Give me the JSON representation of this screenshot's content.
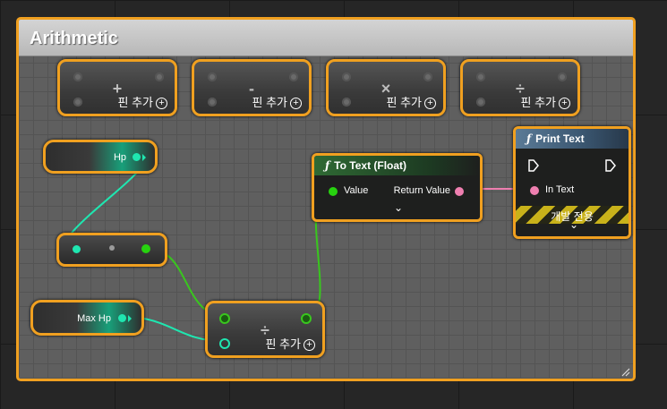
{
  "comment": {
    "title": "Arithmetic"
  },
  "operators": [
    {
      "symbol": "+",
      "add_pin": "핀 추가"
    },
    {
      "symbol": "-",
      "add_pin": "핀 추가"
    },
    {
      "symbol": "×",
      "add_pin": "핀 추가"
    },
    {
      "symbol": "÷",
      "add_pin": "핀 추가"
    }
  ],
  "variables": {
    "hp": "Hp",
    "max_hp": "Max Hp"
  },
  "divide_node": {
    "symbol": "÷",
    "add_pin": "핀 추가"
  },
  "to_text_node": {
    "title": "To Text (Float)",
    "input": "Value",
    "output": "Return Value",
    "expand": "⌄"
  },
  "print_text_node": {
    "title": "Print Text",
    "input": "In Text",
    "dev_only": "개발 전용",
    "expand": "⌄"
  },
  "icons": [
    "function-icon",
    "exec-pin-icon",
    "plus-circle-icon",
    "resize-grip-icon"
  ],
  "colors": {
    "accent": "#f0a020",
    "float_pin": "#27d20f",
    "int_pin": "#1fe6b0",
    "text_pin": "#ef7fb0"
  }
}
